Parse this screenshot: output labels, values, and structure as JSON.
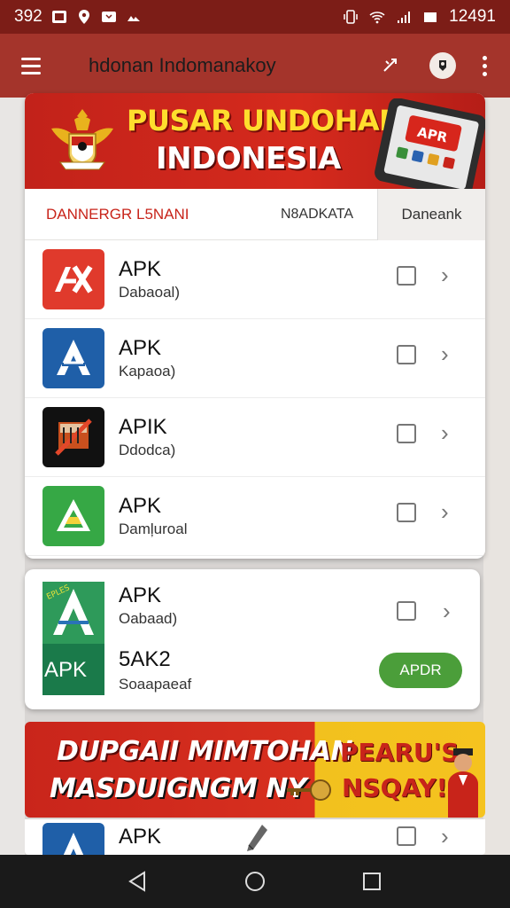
{
  "status_bar": {
    "left_text": "392",
    "time": "12491"
  },
  "app_bar": {
    "title": "hdonan Indomanakoy"
  },
  "banner": {
    "line1": "PUSAR UNDOHAN",
    "line2": "INDONESIA",
    "phone_badge": "APR"
  },
  "tabs": [
    {
      "label": "DANNERGR L5NANI"
    },
    {
      "label": "N8ADKATA"
    },
    {
      "label": "Daneank"
    }
  ],
  "list": [
    {
      "title": "APK",
      "subtitle": "Dabaoal)",
      "icon": "apk-red-icon",
      "icon_color": "#e03a2c"
    },
    {
      "title": "APK",
      "subtitle": "Kapaoa)",
      "icon": "apk-blue-icon",
      "icon_color": "#1f5fa8"
    },
    {
      "title": "APIK",
      "subtitle": "Ddodca)",
      "icon": "apk-black-icon",
      "icon_color": "#111111"
    },
    {
      "title": "APK",
      "subtitle": "Damļuroal",
      "icon": "apk-green-icon",
      "icon_color": "#36a845"
    }
  ],
  "card2": {
    "title": "APK",
    "subtitle": "Oabaad)",
    "title2": "5AK2",
    "subtitle2": "Soaapaeaf",
    "icon_label": "APK",
    "button_label": "APDR",
    "button_color": "#4b9e3a"
  },
  "promo": {
    "line1": "DUPGAII MIMTOHAN",
    "line2": "MASDUIGNGM NY",
    "right1": "PEARU'S",
    "right2": "NSQAY!"
  },
  "bottom_item": {
    "title": "APK"
  },
  "colors": {
    "accent": "#a4342b",
    "tab_active": "#c8241a"
  }
}
